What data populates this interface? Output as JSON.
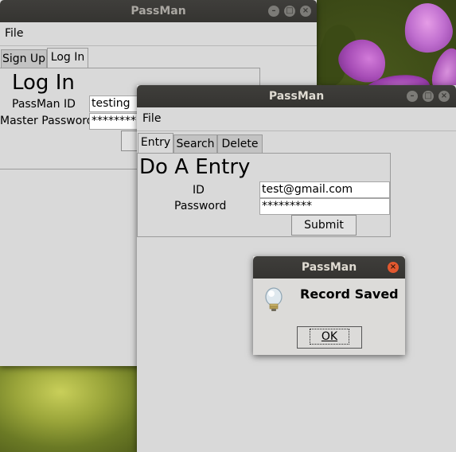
{
  "back_window": {
    "title": "PassMan",
    "menu": {
      "file": "File"
    },
    "tabs": [
      {
        "label": "Sign Up"
      },
      {
        "label": "Log In"
      }
    ],
    "login": {
      "heading": "Log In",
      "id_label": "PassMan ID",
      "id_value": "testing",
      "password_label": "Master Password",
      "password_value": "********"
    }
  },
  "front_window": {
    "title": "PassMan",
    "menu": {
      "file": "File"
    },
    "tabs": [
      {
        "label": "Entry"
      },
      {
        "label": "Search"
      },
      {
        "label": "Delete"
      }
    ],
    "entry": {
      "heading": "Do A Entry",
      "id_label": "ID",
      "id_value": "test@gmail.com",
      "password_label": "Password",
      "password_value": "*********",
      "submit_label": "Submit"
    }
  },
  "dialog": {
    "title": "PassMan",
    "message": "Record Saved",
    "ok_label": "OK",
    "icon": "lightbulb-icon"
  },
  "window_controls": {
    "minimize": "minimize-icon",
    "maximize": "maximize-icon",
    "close": "close-icon"
  }
}
